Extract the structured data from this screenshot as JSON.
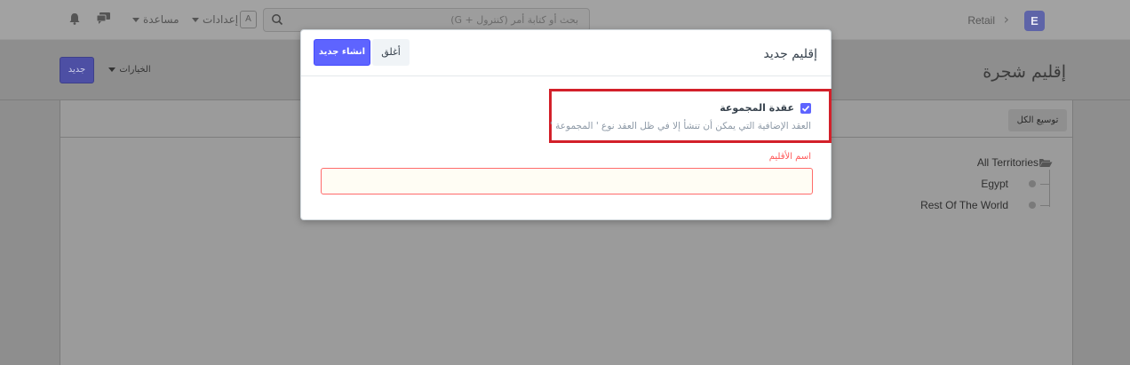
{
  "navbar": {
    "logo_letter": "E",
    "breadcrumb": "Retail",
    "search_placeholder": "بحث أو كتابة أمر (كنترول + G)",
    "kb_letter": "A",
    "settings_label": "إعدادات",
    "help_label": "مساعدة"
  },
  "page": {
    "title": "إقليم شجرة",
    "new_button": "جديد",
    "options_button": "الخيارات"
  },
  "tree": {
    "expand_all": "توسيع الكل",
    "root": "All Territories",
    "children": [
      "Egypt",
      "Rest Of The World"
    ]
  },
  "modal": {
    "title": "إقليم جديد",
    "close_button": "أغلق",
    "create_button": "انشاء جديد",
    "checkbox_label": "عقدة المجموعة",
    "checkbox_checked": true,
    "checkbox_help": "العقد الإضافية التي يمكن أن تنشأ إلا في ظل العقد نوع ' المجموعة '",
    "field_label": "اسم الأقليم",
    "field_value": ""
  },
  "colors": {
    "primary": "#5e64ff",
    "highlight_box": "#d3202a",
    "required_label": "#ff5858"
  }
}
